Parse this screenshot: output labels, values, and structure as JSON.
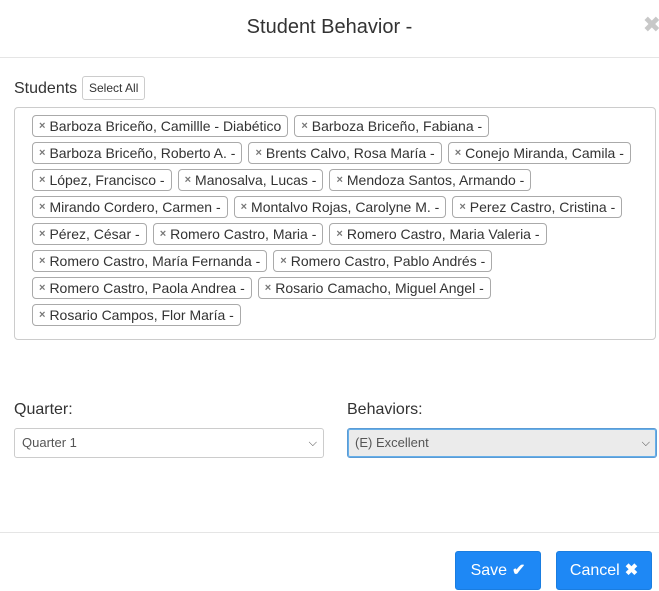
{
  "modal": {
    "title": "Student Behavior -",
    "close_glyph": "✖"
  },
  "students": {
    "label": "Students",
    "select_all_label": "Select All",
    "remove_glyph": "×",
    "selected": [
      "Barboza Briceño, Camillle - Diabético",
      "Barboza Briceño, Fabiana -",
      "Barboza Briceño, Roberto A. -",
      "Brents Calvo, Rosa María -",
      "Conejo Miranda, Camila -",
      "López, Francisco -",
      "Manosalva, Lucas -",
      "Mendoza Santos, Armando -",
      "Mirando Cordero, Carmen -",
      "Montalvo Rojas, Carolyne M. -",
      "Perez Castro, Cristina -",
      "Pérez, César -",
      "Romero Castro, Maria -",
      "Romero Castro, Maria Valeria -",
      "Romero Castro, María Fernanda -",
      "Romero Castro, Pablo Andrés -",
      "Romero Castro, Paola Andrea -",
      "Rosario Camacho, Miguel Angel -",
      "Rosario Campos, Flor María -"
    ]
  },
  "quarter": {
    "label": "Quarter:",
    "selected": "Quarter 1"
  },
  "behaviors": {
    "label": "Behaviors:",
    "selected": "(E) Excellent"
  },
  "footer": {
    "save_label": "Save",
    "save_icon": "✔",
    "cancel_label": "Cancel",
    "cancel_icon": "✖"
  },
  "colors": {
    "primary_button": "#1e88f5",
    "focus_border": "#5b9bd5"
  }
}
